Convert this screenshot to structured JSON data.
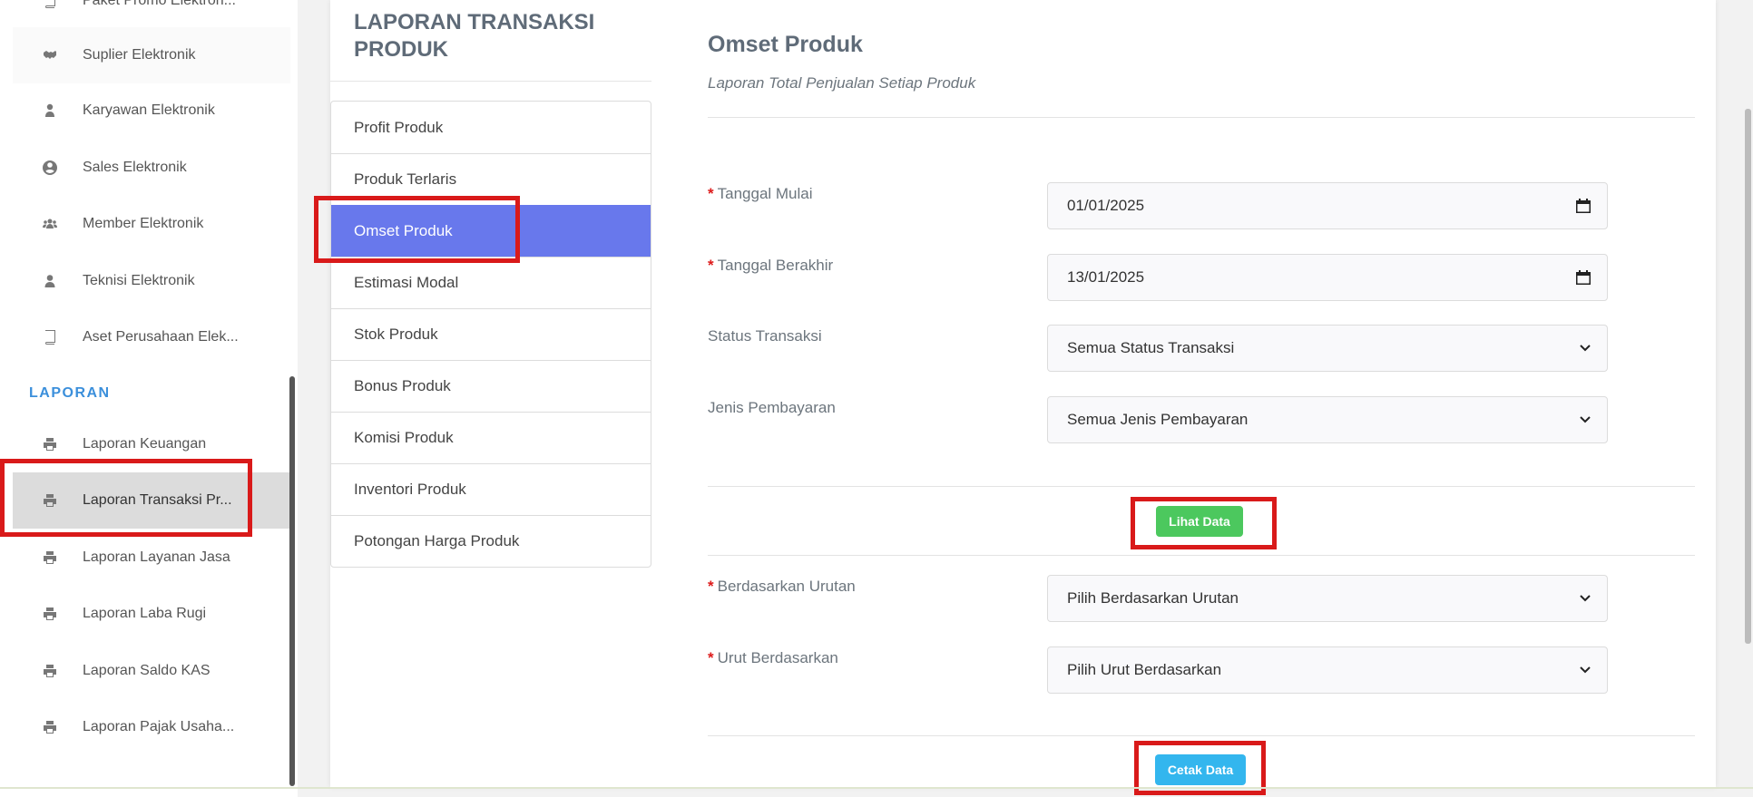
{
  "sidebar": {
    "items": [
      {
        "label": "Paket Promo Elektron...",
        "icon": "book-icon"
      },
      {
        "label": "Suplier Elektronik",
        "icon": "handshake-icon"
      },
      {
        "label": "Karyawan Elektronik",
        "icon": "user-tie-icon"
      },
      {
        "label": "Sales Elektronik",
        "icon": "user-circle-icon"
      },
      {
        "label": "Member Elektronik",
        "icon": "users-icon"
      },
      {
        "label": "Teknisi Elektronik",
        "icon": "user-icon"
      },
      {
        "label": "Aset Perusahaan Elek...",
        "icon": "book-icon"
      }
    ],
    "section_heading": "LAPORAN",
    "report_items": [
      {
        "label": "Laporan Keuangan",
        "icon": "print-icon"
      },
      {
        "label": "Laporan Transaksi Pr...",
        "icon": "print-icon"
      },
      {
        "label": "Laporan Layanan Jasa",
        "icon": "print-icon"
      },
      {
        "label": "Laporan Laba Rugi",
        "icon": "print-icon"
      },
      {
        "label": "Laporan Saldo KAS",
        "icon": "print-icon"
      },
      {
        "label": "Laporan Pajak Usaha...",
        "icon": "print-icon"
      }
    ]
  },
  "card": {
    "title": "LAPORAN TRANSAKSI PRODUK",
    "nav": [
      "Profit Produk",
      "Produk Terlaris",
      "Omset Produk",
      "Estimasi Modal",
      "Stok Produk",
      "Bonus Produk",
      "Komisi Produk",
      "Inventori Produk",
      "Potongan Harga Produk"
    ]
  },
  "section": {
    "title": "Omset Produk",
    "subtitle": "Laporan Total Penjualan Setiap Produk"
  },
  "form": {
    "required_mark": "*",
    "start_date": {
      "label": "Tanggal Mulai",
      "value": "01/01/2025"
    },
    "end_date": {
      "label": "Tanggal Berakhir",
      "value": "13/01/2025"
    },
    "status": {
      "label": "Status Transaksi",
      "value": "Semua Status Transaksi"
    },
    "payment": {
      "label": "Jenis Pembayaran",
      "value": "Semua Jenis Pembayaran"
    },
    "view_button": "Lihat Data",
    "order_by": {
      "label": "Berdasarkan Urutan",
      "value": "Pilih Berdasarkan Urutan"
    },
    "sort_by": {
      "label": "Urut Berdasarkan",
      "value": "Pilih Urut Berdasarkan"
    },
    "print_button": "Cetak Data"
  },
  "colors": {
    "active_nav": "#6878ec",
    "green_button": "#4cc85e",
    "blue_button": "#33b6ee",
    "highlight": "#d91a1a",
    "section_heading": "#3b8fdb"
  }
}
